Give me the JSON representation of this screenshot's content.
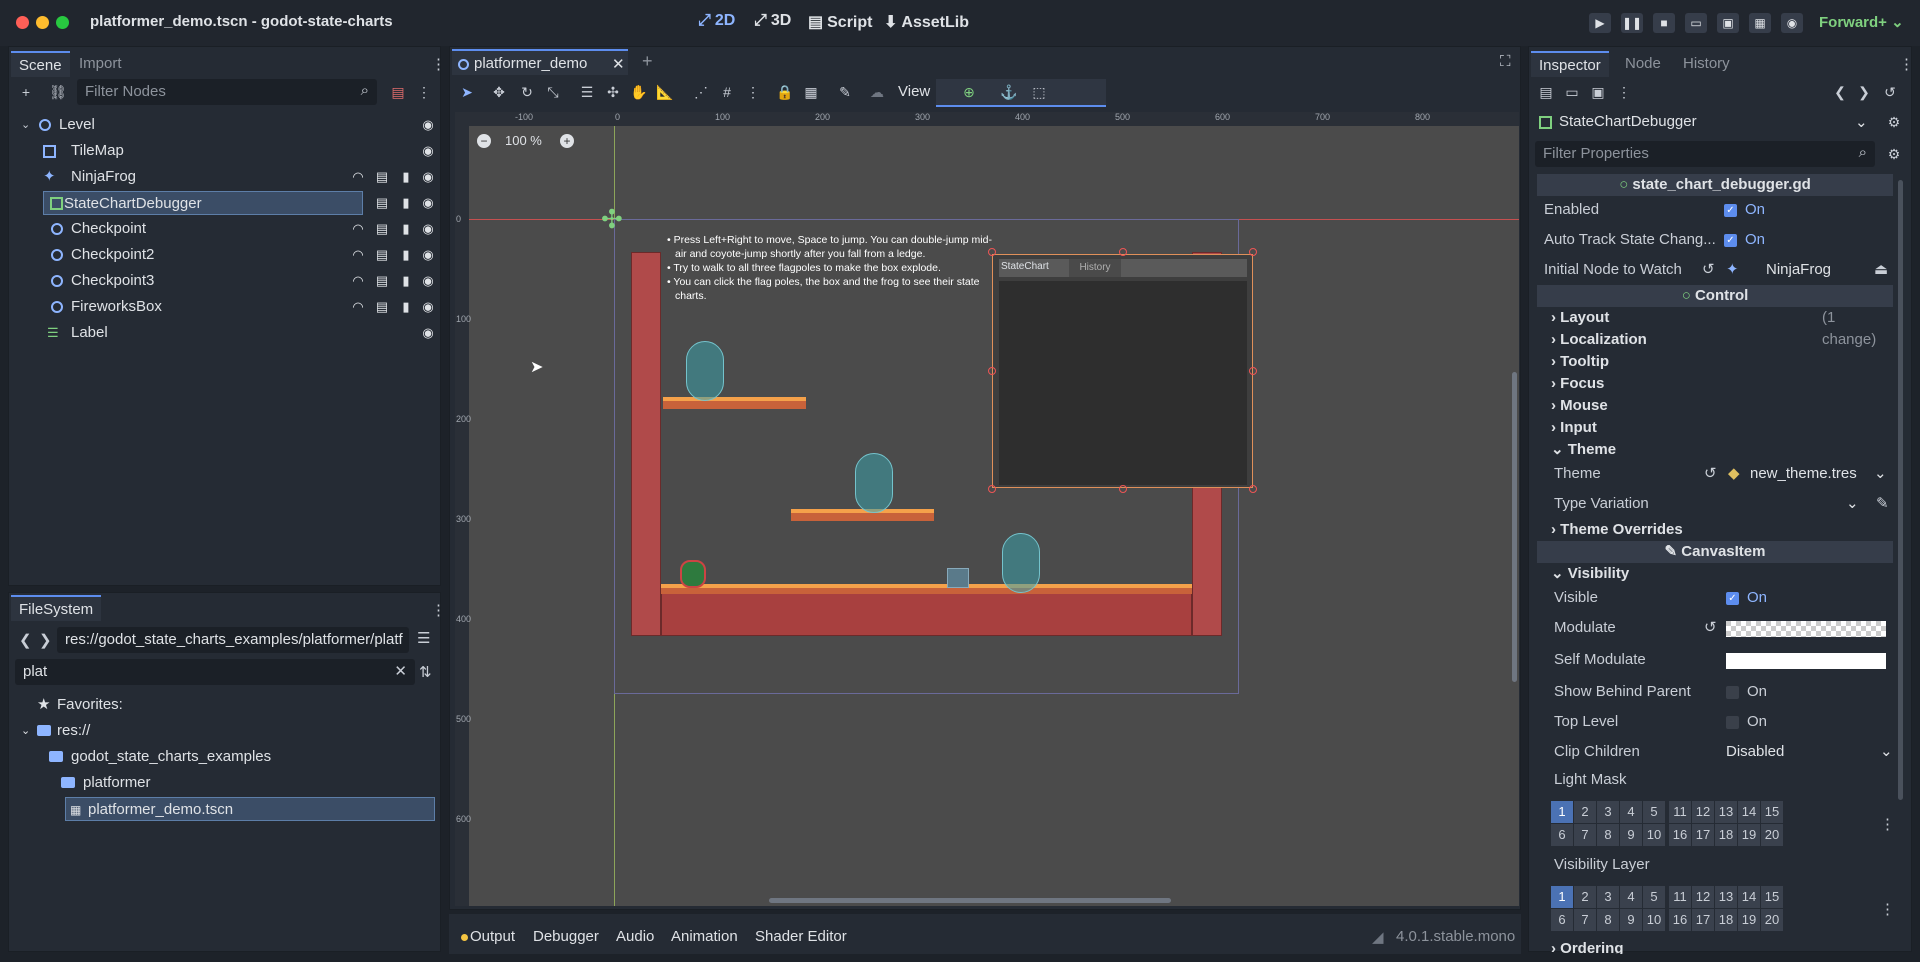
{
  "window": {
    "title": "platformer_demo.tscn - godot-state-charts"
  },
  "modes": {
    "m2d": "2D",
    "m3d": "3D",
    "script": "Script",
    "assetlib": "AssetLib"
  },
  "renderer": "Forward+",
  "scene_dock": {
    "tabs": [
      "Scene",
      "Import"
    ],
    "filter_placeholder": "Filter Nodes",
    "nodes": [
      {
        "name": "Level",
        "icon": "node2d-icon"
      },
      {
        "name": "TileMap",
        "icon": "tilemap-icon"
      },
      {
        "name": "NinjaFrog",
        "icon": "character-icon"
      },
      {
        "name": "StateChartDebugger",
        "icon": "control-icon"
      },
      {
        "name": "Checkpoint",
        "icon": "node2d-icon"
      },
      {
        "name": "Checkpoint2",
        "icon": "node2d-icon"
      },
      {
        "name": "Checkpoint3",
        "icon": "node2d-icon"
      },
      {
        "name": "FireworksBox",
        "icon": "node2d-icon"
      },
      {
        "name": "Label",
        "icon": "label-icon"
      }
    ]
  },
  "filesystem": {
    "tab": "FileSystem",
    "path": "res://godot_state_charts_examples/platformer/platf",
    "search": "plat",
    "favorites": "Favorites:",
    "items": [
      "res://",
      "godot_state_charts_examples",
      "platformer",
      "platformer_demo.tscn"
    ]
  },
  "editor": {
    "tab": "platformer_demo",
    "view_label": "View",
    "zoom": "100 %",
    "ruler_h": [
      "-100",
      "0",
      "100",
      "200",
      "300",
      "400",
      "500",
      "600",
      "700",
      "800"
    ],
    "ruler_v": [
      "0",
      "100",
      "200",
      "300",
      "400",
      "500",
      "600"
    ],
    "label_lines": [
      "• Press Left+Right to move, Space to jump. You can double-jump mid-",
      "air and coyote-jump shortly after you fall from a ledge.",
      "• Try to walk to all three flagpoles to make the box explode.",
      "• You can click the flag poles, the box and the frog to see their state",
      "charts."
    ],
    "debugger_tabs": [
      "StateChart",
      "History"
    ]
  },
  "bottom_panel": {
    "tabs": [
      "Output",
      "Debugger",
      "Audio",
      "Animation",
      "Shader Editor"
    ],
    "version": "4.0.1.stable.mono"
  },
  "inspector": {
    "tabs": [
      "Inspector",
      "Node",
      "History"
    ],
    "object": "StateChartDebugger",
    "filter_placeholder": "Filter Properties",
    "script": "state_chart_debugger.gd",
    "rows": {
      "enabled": {
        "label": "Enabled",
        "value": "On"
      },
      "auto_track": {
        "label": "Auto Track State Chang...",
        "value": "On"
      },
      "initial_node": {
        "label": "Initial Node to Watch",
        "value": "NinjaFrog"
      }
    },
    "control_header": "Control",
    "sections": [
      "Layout",
      "Localization",
      "Tooltip",
      "Focus",
      "Mouse",
      "Input",
      "Theme"
    ],
    "layout_changes": "(1 change)",
    "theme": {
      "label": "Theme",
      "value": "new_theme.tres"
    },
    "type_variation": {
      "label": "Type Variation"
    },
    "theme_overrides": "Theme Overrides",
    "canvasitem_header": "CanvasItem",
    "visibility": "Visibility",
    "vis_rows": {
      "visible": {
        "label": "Visible",
        "value": "On"
      },
      "modulate": {
        "label": "Modulate"
      },
      "self_modulate": {
        "label": "Self Modulate"
      },
      "show_behind": {
        "label": "Show Behind Parent",
        "value": "On"
      },
      "top_level": {
        "label": "Top Level",
        "value": "On"
      },
      "clip_children": {
        "label": "Clip Children",
        "value": "Disabled"
      },
      "light_mask": {
        "label": "Light Mask"
      },
      "visibility_layer": {
        "label": "Visibility Layer"
      }
    },
    "ordering": "Ordering",
    "layer_numbers_top": [
      "1",
      "2",
      "3",
      "4",
      "5",
      "11",
      "12",
      "13",
      "14",
      "15"
    ],
    "layer_numbers_bottom": [
      "6",
      "7",
      "8",
      "9",
      "10",
      "16",
      "17",
      "18",
      "19",
      "20"
    ]
  }
}
